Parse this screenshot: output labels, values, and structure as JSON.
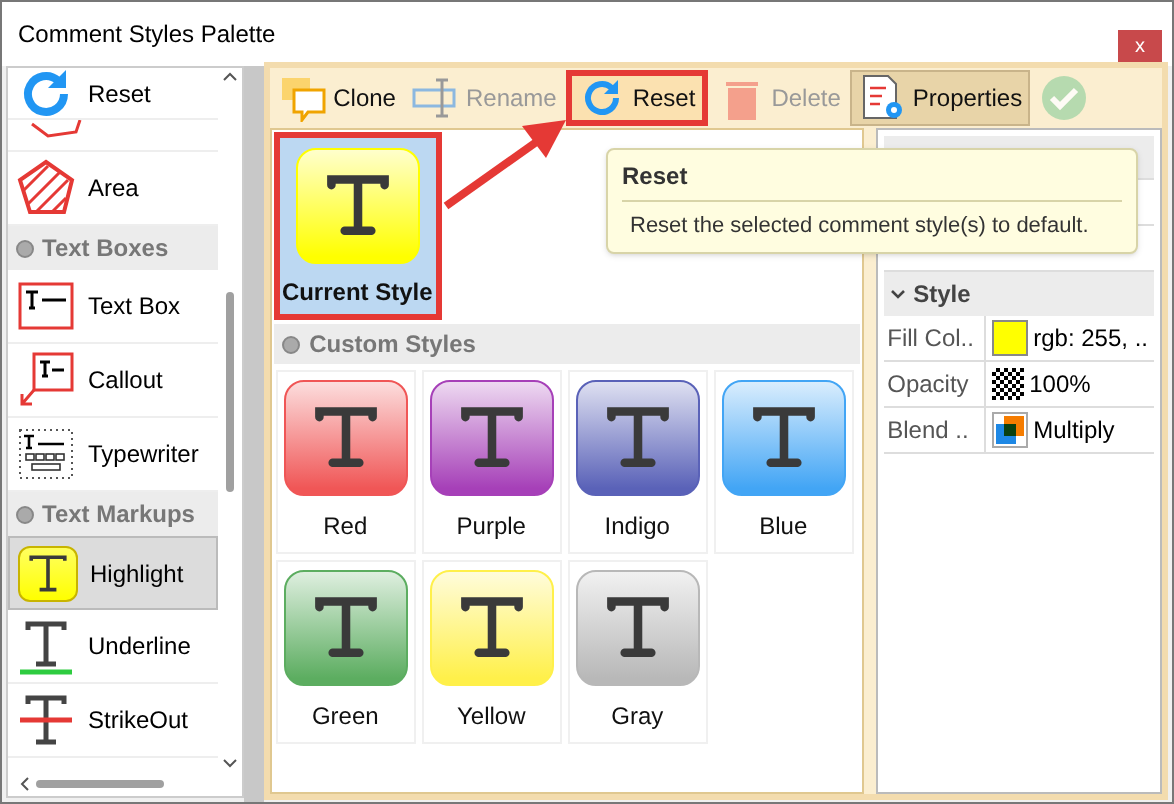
{
  "window": {
    "title": "Comment Styles Palette",
    "close": "x"
  },
  "sidebar": {
    "items": [
      {
        "kind": "item",
        "label": "Reset",
        "selected": false
      },
      {
        "kind": "partial"
      },
      {
        "kind": "item",
        "label": "Area",
        "selected": false
      },
      {
        "kind": "header",
        "label": "Text Boxes"
      },
      {
        "kind": "item",
        "label": "Text Box",
        "selected": false
      },
      {
        "kind": "item",
        "label": "Callout",
        "selected": false
      },
      {
        "kind": "item",
        "label": "Typewriter",
        "selected": false
      },
      {
        "kind": "header",
        "label": "Text Markups"
      },
      {
        "kind": "item",
        "label": "Highlight",
        "selected": true
      },
      {
        "kind": "item",
        "label": "Underline",
        "selected": false
      },
      {
        "kind": "item",
        "label": "StrikeOut",
        "selected": false
      }
    ]
  },
  "toolbar": [
    {
      "label": "Clone",
      "disabled": false,
      "highlighted": false,
      "pressed": false
    },
    {
      "label": "Rename",
      "disabled": true,
      "highlighted": false,
      "pressed": false
    },
    {
      "label": "Reset",
      "disabled": false,
      "highlighted": true,
      "pressed": false
    },
    {
      "label": "Delete",
      "disabled": true,
      "highlighted": false,
      "pressed": false
    },
    {
      "label": "Properties",
      "disabled": false,
      "highlighted": false,
      "pressed": true
    },
    {
      "disabled": true,
      "highlighted": false,
      "pressed": false
    }
  ],
  "current_style": {
    "label": "Current Style",
    "color": "#ffff00",
    "selected": true
  },
  "custom_styles": {
    "header": "Custom Styles",
    "items": [
      {
        "label": "Red",
        "color": "#f05656",
        "selected": false
      },
      {
        "label": "Purple",
        "color": "#a640b8",
        "selected": false
      },
      {
        "label": "Indigo",
        "color": "#5a62b8",
        "selected": false
      },
      {
        "label": "Blue",
        "color": "#42a5f5",
        "selected": false
      },
      {
        "label": "Green",
        "color": "#5cad60",
        "selected": false
      },
      {
        "label": "Yellow",
        "color": "#fff04a",
        "selected": false
      },
      {
        "label": "Gray",
        "color": "#b8b8b8",
        "selected": false
      }
    ]
  },
  "tooltip": {
    "title": "Reset",
    "text": "Reset the selected comment style(s) to default."
  },
  "properties": {
    "section": {
      "label": "Style",
      "expanded": true,
      "rows": [
        {
          "kind": "color",
          "name": "Fill Col..",
          "value": "rgb: 255, ..",
          "color": "#ffff00"
        },
        {
          "kind": "opacity",
          "name": "Opacity",
          "value": "100%"
        },
        {
          "kind": "blend",
          "name": "Blend ..",
          "value": "Multiply"
        }
      ]
    }
  }
}
